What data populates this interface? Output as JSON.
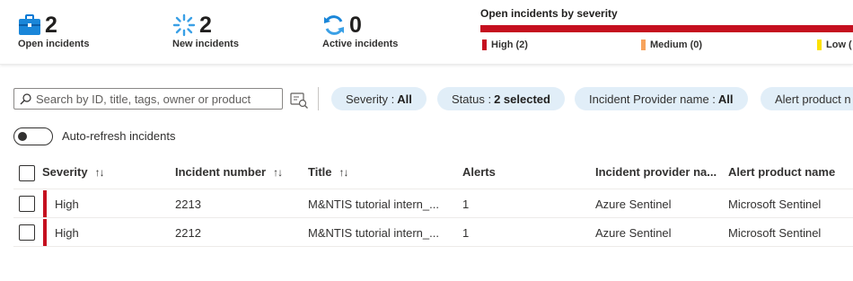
{
  "stats": {
    "open": {
      "value": "2",
      "label": "Open incidents",
      "icon": "briefcase-icon"
    },
    "new": {
      "value": "2",
      "label": "New incidents",
      "icon": "spinner-icon"
    },
    "active": {
      "value": "0",
      "label": "Active incidents",
      "icon": "refresh-icon"
    }
  },
  "severity_panel": {
    "title": "Open incidents by severity",
    "legend": [
      {
        "label": "High (2)",
        "color": "#c50f1f",
        "count": 2
      },
      {
        "label": "Medium (0)",
        "color": "#f7a35c",
        "count": 0
      },
      {
        "label": "Low (",
        "color": "#fce100",
        "count": 0
      }
    ]
  },
  "toolbar": {
    "search_placeholder": "Search by ID, title, tags, owner or product",
    "filters": [
      {
        "name": "Severity :",
        "value": "All"
      },
      {
        "name": "Status :",
        "value": "2 selected"
      },
      {
        "name": "Incident Provider name :",
        "value": "All"
      },
      {
        "name": "Alert product n",
        "value": ""
      }
    ]
  },
  "auto_refresh": {
    "label": "Auto-refresh incidents",
    "enabled": false
  },
  "table": {
    "columns": [
      "Severity",
      "Incident number",
      "Title",
      "Alerts",
      "Incident provider na...",
      "Alert product name"
    ],
    "sort_glyph": "↑↓",
    "rows": [
      {
        "severity": "High",
        "number": "2213",
        "title": "M&NTIS tutorial intern_...",
        "alerts": "1",
        "provider": "Azure Sentinel",
        "product": "Microsoft Sentinel"
      },
      {
        "severity": "High",
        "number": "2212",
        "title": "M&NTIS tutorial intern_...",
        "alerts": "1",
        "provider": "Azure Sentinel",
        "product": "Microsoft Sentinel"
      }
    ]
  },
  "colors": {
    "accent": "#0078d4",
    "high": "#c50f1f",
    "filter_pill": "#e1eef8"
  }
}
